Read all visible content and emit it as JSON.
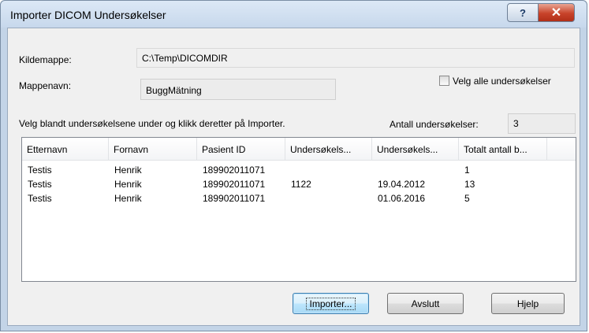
{
  "window": {
    "title": "Importer DICOM Undersøkelser",
    "help_glyph": "?",
    "close_glyph": "✕"
  },
  "form": {
    "source_label": "Kildemappe:",
    "source_value": "C:\\Temp\\DICOMDIR",
    "folder_label": "Mappenavn:",
    "folder_value": "BuggMätning",
    "select_all_label": "Velg alle undersøkelser",
    "select_all_checked": false,
    "instruction": "Velg blandt undersøkelsene under og klikk deretter på Importer.",
    "count_label": "Antall undersøkelser:",
    "count_value": "3"
  },
  "table": {
    "columns": [
      "Etternavn",
      "Fornavn",
      "Pasient ID",
      "Undersøkels...",
      "Undersøkels...",
      "Totalt antall b..."
    ],
    "rows": [
      [
        "Testis",
        "Henrik",
        "189902011071",
        "",
        "",
        "1"
      ],
      [
        "Testis",
        "Henrik",
        "189902011071",
        "1122",
        "19.04.2012",
        "13"
      ],
      [
        "Testis",
        "Henrik",
        "189902011071",
        "",
        "01.06.2016",
        "5"
      ]
    ]
  },
  "buttons": {
    "import": "Importer...",
    "close": "Avslutt",
    "help": "Hjelp"
  }
}
